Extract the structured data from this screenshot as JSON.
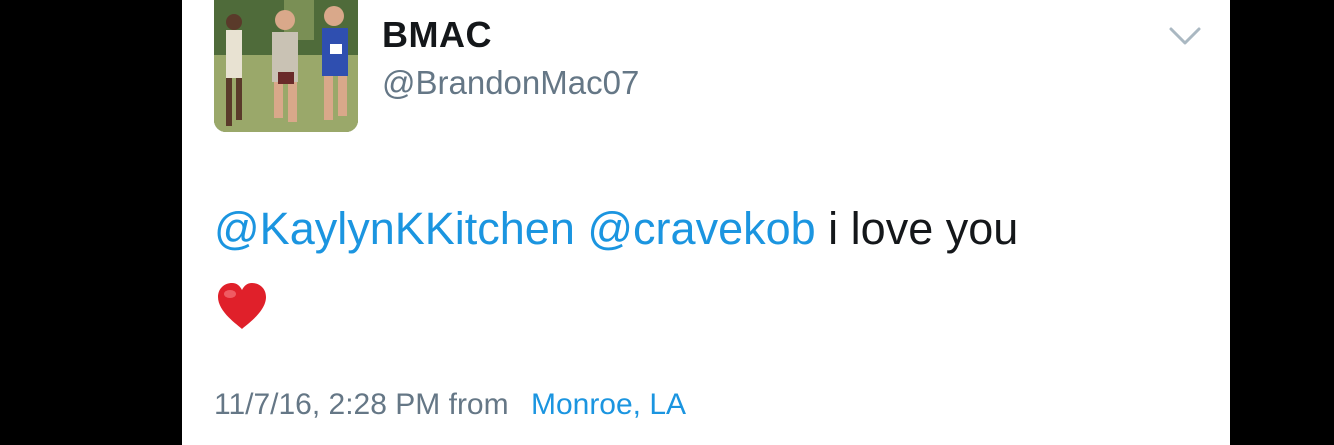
{
  "tweet": {
    "display_name": "BMAC",
    "handle": "@BrandonMac07",
    "mentions": [
      "@KaylynKKitchen",
      "@cravekob"
    ],
    "text": "i love you",
    "emoji": "red-heart",
    "timestamp": "11/7/16, 2:28 PM",
    "from_label": "from",
    "location": "Monroe, LA"
  },
  "icons": {
    "menu": "chevron-down-icon",
    "avatar": "profile-photo"
  },
  "colors": {
    "link": "#1b95e0",
    "name": "#14171a",
    "secondary": "#657786",
    "background": "#ffffff",
    "frame": "#000000",
    "heart": "#e0202a"
  }
}
